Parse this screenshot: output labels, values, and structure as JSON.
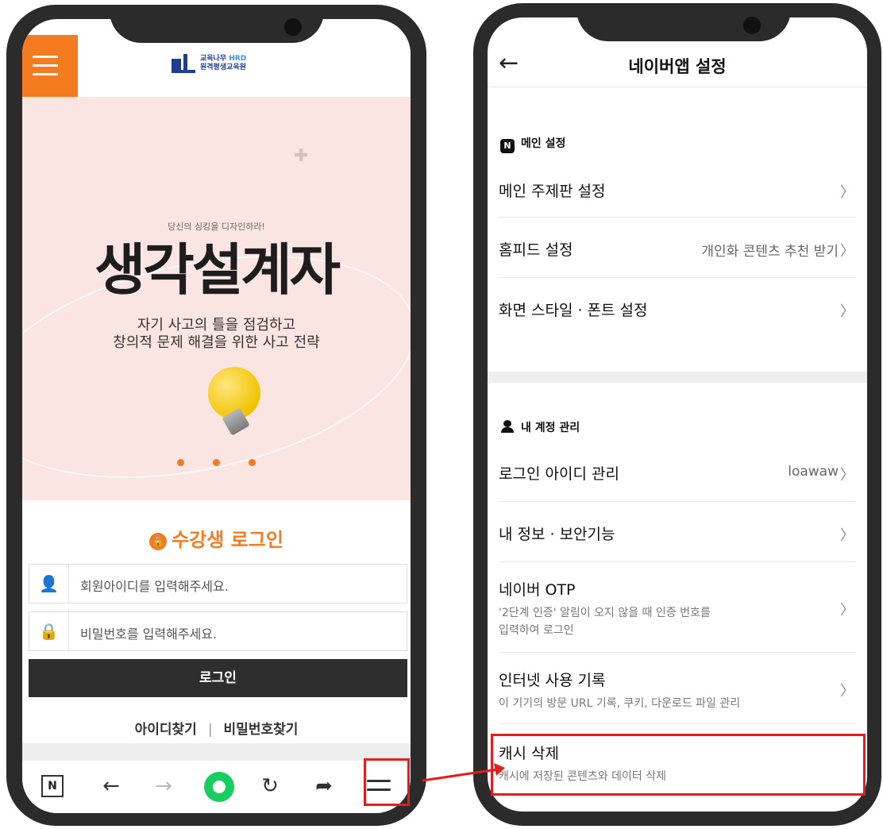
{
  "left_screen": {
    "logo": {
      "line1": "교육나무",
      "hrd": "HRD",
      "line2": "원격평생교육원"
    },
    "banner": {
      "subtitle": "당신의 싱킹을 디자인하라!",
      "title": "생각설계자",
      "desc_line1": "자기 사고의 틀을 점검하고",
      "desc_line2": "창의적 문제 해결을 위한 사고 전략"
    },
    "login": {
      "title": "수강생 로그인",
      "id_placeholder": "회원아이디를 입력해주세요.",
      "pw_placeholder": "비밀번호를 입력해주세요.",
      "button": "로그인",
      "find_id": "아이디찾기",
      "separator": "|",
      "find_pw": "비밀번호찾기"
    },
    "bottom_nav": {
      "naver_box": "N",
      "icons": [
        "n-box-icon",
        "back-arrow-icon",
        "forward-arrow-icon",
        "green-home-icon",
        "refresh-icon",
        "share-icon",
        "menu-icon"
      ]
    }
  },
  "right_screen": {
    "header": {
      "back": "←",
      "title": "네이버앱 설정"
    },
    "main_section": {
      "label": "메인 설정",
      "badge": "N",
      "items": [
        {
          "label": "메인 주제판 설정",
          "value": ""
        },
        {
          "label": "홈피드 설정",
          "value": "개인화 콘텐츠 추천 받기"
        },
        {
          "label": "화면 스타일 · 폰트 설정",
          "value": ""
        }
      ]
    },
    "account_section": {
      "label": "내 계정 관리",
      "items": [
        {
          "label": "로그인 아이디 관리",
          "value": "loawaw"
        },
        {
          "label": "내 정보 · 보안기능",
          "value": ""
        },
        {
          "label": "네이버 OTP",
          "sub1": "'2단계 인증' 알림이 오지 않을 때 인증 번호를",
          "sub2": "입력하여 로그인"
        },
        {
          "label": "인터넷 사용 기록",
          "sub1": "이 기기의 방문 URL 기록, 쿠키, 다운로드 파일 관리"
        },
        {
          "label": "캐시 삭제",
          "sub1": "캐시에 저장된 콘텐츠와 데이터 삭제"
        }
      ]
    }
  },
  "colors": {
    "orange": "#f47b20",
    "highlight_red": "#e41c1c",
    "naver_green": "#19ce60",
    "banner_pink": "#fbe5e3"
  }
}
